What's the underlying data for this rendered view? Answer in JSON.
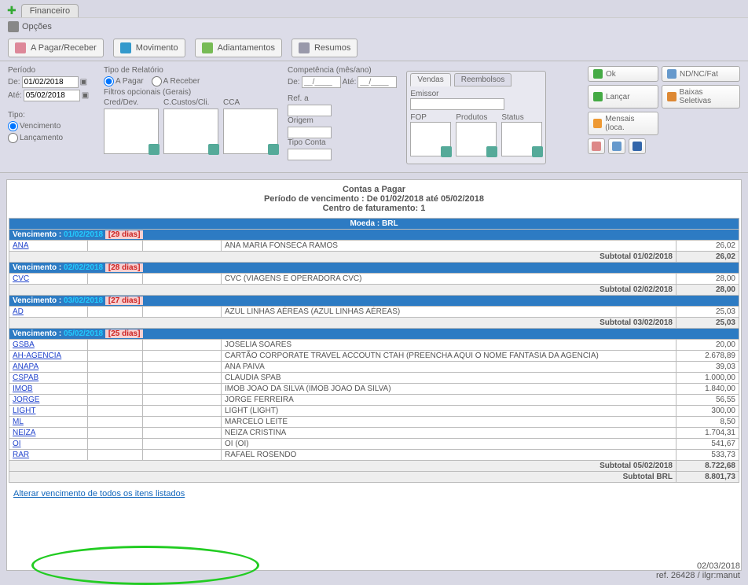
{
  "tab": "Financeiro",
  "options_label": "Opções",
  "toolbar": {
    "pagar": "A Pagar/Receber",
    "movimento": "Movimento",
    "adiantamentos": "Adiantamentos",
    "resumo": "Resumos"
  },
  "filters": {
    "periodo": {
      "label": "Período",
      "de_lbl": "De:",
      "de": "01/02/2018",
      "ate_lbl": "Até:",
      "ate": "05/02/2018"
    },
    "tipo": {
      "label": "Tipo:",
      "venc": "Vencimento",
      "lanc": "Lançamento"
    },
    "tiporel": {
      "label": "Tipo de Relatório",
      "apagar": "A Pagar",
      "areceber": "A Receber"
    },
    "filtros_lbl": "Filtros opcionais (Gerais)",
    "cols": {
      "cred": "Cred/Dev.",
      "ccustos": "C.Custos/Cli.",
      "cca": "CCA"
    },
    "competencia": {
      "label": "Competência (mês/ano)",
      "de": "De:",
      "ate": "Até:",
      "placeholder": "__/____"
    },
    "ref": {
      "label": "Ref. a",
      "origem": "Origem",
      "tipoconta": "Tipo Conta"
    },
    "sub": {
      "vendas": "Vendas",
      "reembolsos": "Reembolsos",
      "emissor": "Emissor",
      "fop": "FOP",
      "produtos": "Produtos",
      "status": "Status"
    }
  },
  "actions": {
    "ok": "Ok",
    "lancar": "Lançar",
    "ndnc": "ND/NC/Fat",
    "baixas": "Baixas Seletivas",
    "mensais": "Mensais (loca."
  },
  "report": {
    "title1": "Contas a Pagar",
    "title2": "Período de vencimento : De 01/02/2018 até 05/02/2018",
    "title3": "Centro de faturamento: 1",
    "moeda": "Moeda : BRL",
    "sub_prefix": "Subtotal",
    "sub_brl": "Subtotal BRL",
    "total_brl": "8.801,73",
    "groups": [
      {
        "venc": "Vencimento :",
        "date": "01/02/2018",
        "ago": "[29 dias]",
        "rows": [
          {
            "code": "ANA",
            "name": "ANA MARIA FONSECA RAMOS",
            "amt": "26,02"
          }
        ],
        "sub_date": "01/02/2018",
        "sub_amt": "26,02"
      },
      {
        "venc": "Vencimento :",
        "date": "02/02/2018",
        "ago": "[28 dias]",
        "rows": [
          {
            "code": "CVC",
            "name": "CVC (VIAGENS E OPERADORA CVC)",
            "amt": "28,00"
          }
        ],
        "sub_date": "02/02/2018",
        "sub_amt": "28,00"
      },
      {
        "venc": "Vencimento :",
        "date": "03/02/2018",
        "ago": "[27 dias]",
        "rows": [
          {
            "code": "AD",
            "name": "AZUL LINHAS AÉREAS (AZUL LINHAS AÉREAS)",
            "amt": "25,03"
          }
        ],
        "sub_date": "03/02/2018",
        "sub_amt": "25,03"
      },
      {
        "venc": "Vencimento :",
        "date": "05/02/2018",
        "ago": "[25 dias]",
        "rows": [
          {
            "code": "GSBA",
            "name": "JOSELIA SOARES",
            "amt": "20,00"
          },
          {
            "code": "AH-AGENCIA",
            "name": "CARTÃO CORPORATE TRAVEL ACCOUTN CTAH (PREENCHA AQUI O NOME FANTASIA DA AGENCIA)",
            "amt": "2.678,89"
          },
          {
            "code": "ANAPA",
            "name": "ANA PAIVA",
            "amt": "39,03"
          },
          {
            "code": "CSPAB",
            "name": "CLAUDIA SPAB",
            "amt": "1.000,00"
          },
          {
            "code": "IMOB",
            "name": "IMOB JOAO DA SILVA (IMOB JOAO DA SILVA)",
            "amt": "1.840,00"
          },
          {
            "code": "JORGE",
            "name": "JORGE FERREIRA",
            "amt": "56,55"
          },
          {
            "code": "LIGHT",
            "name": "LIGHT (LIGHT)",
            "amt": "300,00"
          },
          {
            "code": "ML",
            "name": "MARCELO LEITE",
            "amt": "8,50"
          },
          {
            "code": "NEIZA",
            "name": "NEIZA CRISTINA",
            "amt": "1.704,31"
          },
          {
            "code": "OI",
            "name": "OI (OI)",
            "amt": "541,67"
          },
          {
            "code": "RAR",
            "name": "RAFAEL ROSENDO",
            "amt": "533,73"
          }
        ],
        "sub_date": "05/02/2018",
        "sub_amt": "8.722,68"
      }
    ]
  },
  "alter_link": "Alterar vencimento de todos os itens listados",
  "footer": {
    "date": "02/03/2018",
    "ref": "ref. 26428 / ilgr:manut"
  }
}
